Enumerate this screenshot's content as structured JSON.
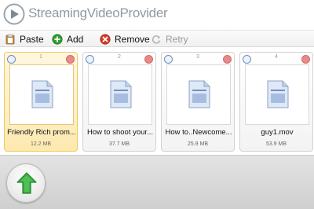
{
  "header": {
    "brand": "StreamingVideoProvider",
    "logo_icon": "play-logo-icon"
  },
  "toolbar": {
    "paste_label": "Paste",
    "add_label": "Add",
    "remove_label": "Remove",
    "retry_label": "Retry",
    "paste_icon": "clipboard-icon",
    "add_icon": "plus-circle-icon",
    "remove_icon": "x-circle-icon",
    "retry_icon": "retry-icon"
  },
  "files": [
    {
      "num": "1",
      "name": "Friendly Rich prom...",
      "size": "12.2 MB",
      "selected": true
    },
    {
      "num": "2",
      "name": "How to shoot your...",
      "size": "37.7 MB",
      "selected": false
    },
    {
      "num": "3",
      "name": "How to..Newcome...",
      "size": "25.9 MB",
      "selected": false
    },
    {
      "num": "4",
      "name": "guy1.mov",
      "size": "53.9 MB",
      "selected": false
    }
  ],
  "colors": {
    "selected_bg": "#fde9b0",
    "selected_border": "#f0c860",
    "upload_arrow": "#3cb043",
    "remove": "#d23a2a",
    "add": "#2e9e2e"
  },
  "upload": {
    "icon": "up-arrow-icon"
  }
}
